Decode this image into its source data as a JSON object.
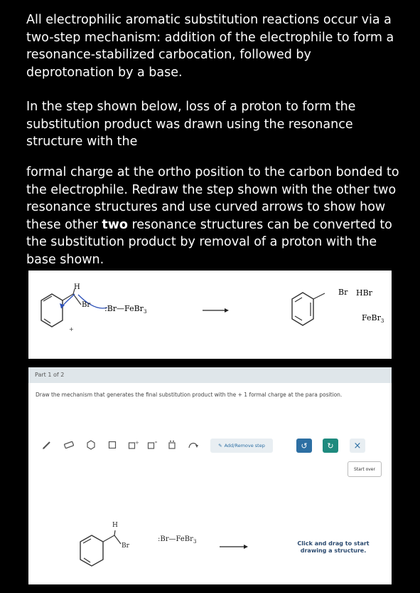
{
  "intro": {
    "p1": "All electrophilic aromatic substitution reactions occur via a two-step mechanism: addition of the electrophile to form a resonance-stabilized carbocation, followed by deprotonation by a base.",
    "p2": "In the step shown below, loss of a proton to form the substitution product was drawn using the resonance structure with the",
    "p3_pre": " formal charge at the ortho position to the carbon bonded to the electrophile. Redraw the step shown with the other two resonance structures and use curved arrows to show how these other ",
    "p3_bold": "two",
    "p3_post": " resonance structures can be converted to the substitution product by removal of a proton with the base shown."
  },
  "example": {
    "h_label": "H",
    "br_label": "Br",
    "base_label": ":Br—FeBr",
    "base_sub": "3",
    "product_br": "Br",
    "hbr": "HBr",
    "febr": "FeBr",
    "febr_sub": "3"
  },
  "part": {
    "label": "Part 1 of 2",
    "instruction": "Draw the mechanism that generates the final substitution product with the + 1 formal charge at the para position."
  },
  "toolbar": {
    "add_remove_step": "Add/Remove step",
    "start_over": "Start over",
    "close_symbol": "×"
  },
  "canvas": {
    "h_label": "H",
    "br_label": "Br",
    "base_label": ":Br—FeBr",
    "base_sub": "3",
    "hint_line1": "Click and drag to start",
    "hint_line2": "drawing a structure."
  },
  "colors": {
    "background": "#000000",
    "part_header": "#dfe6ea",
    "button_blue": "#2d6fa3",
    "button_teal": "#1e8a7e",
    "arrow_blue": "#2b4fb8",
    "hint_blue": "#2b4a6f"
  }
}
